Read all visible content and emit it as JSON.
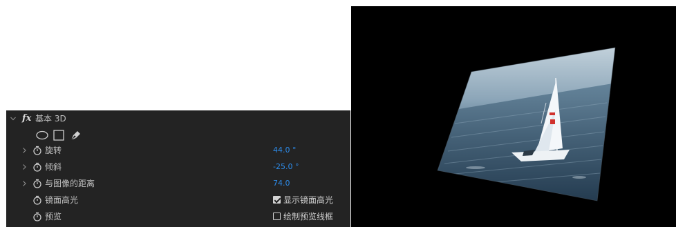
{
  "effect": {
    "fx_icon": "fx",
    "title": "基本 3D",
    "tools": [
      {
        "name": "ellipse-mask-icon"
      },
      {
        "name": "rectangle-mask-icon"
      },
      {
        "name": "pen-mask-icon"
      }
    ],
    "properties": [
      {
        "label": "旋转",
        "value": "44.0",
        "unit": "°",
        "expandable": true
      },
      {
        "label": "倾斜",
        "value": "-25.0",
        "unit": "°",
        "expandable": true
      },
      {
        "label": "与图像的距离",
        "value": "74.0",
        "unit": "",
        "expandable": true
      },
      {
        "label": "镜面高光",
        "checkbox": true,
        "checked": true,
        "checkbox_label": "显示镜面高光"
      },
      {
        "label": "预览",
        "checkbox": true,
        "checked": false,
        "checkbox_label": "绘制预览线框"
      }
    ]
  },
  "colors": {
    "panel_bg": "#232323",
    "value_blue": "#2d8ceb",
    "label_text": "#c2c2c2",
    "preview_bg": "#000000"
  }
}
